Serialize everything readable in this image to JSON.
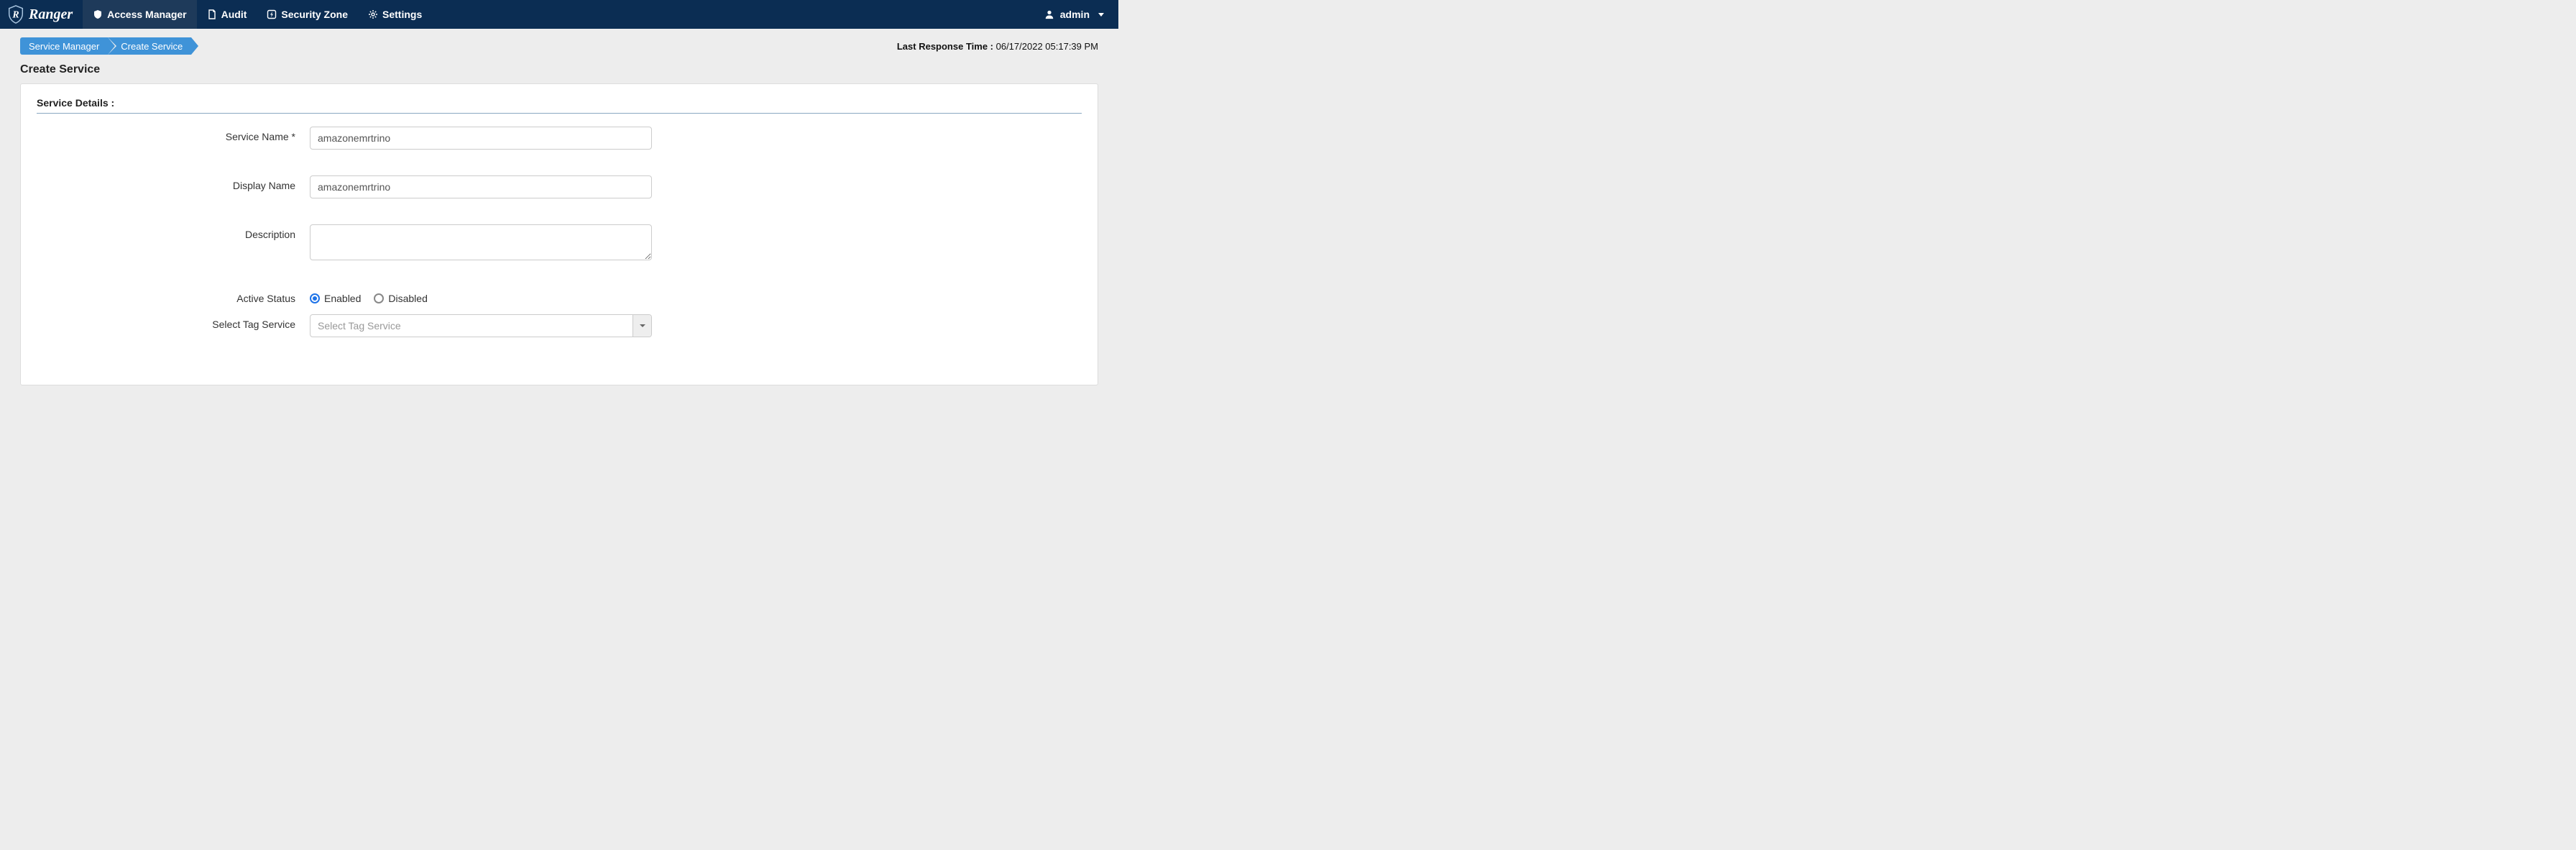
{
  "brand": {
    "name": "Ranger"
  },
  "nav": {
    "items": [
      {
        "label": "Access Manager"
      },
      {
        "label": "Audit"
      },
      {
        "label": "Security Zone"
      },
      {
        "label": "Settings"
      }
    ]
  },
  "user": {
    "name": "admin"
  },
  "breadcrumb": {
    "items": [
      {
        "label": "Service Manager"
      },
      {
        "label": "Create Service"
      }
    ]
  },
  "timestamp": {
    "label": "Last Response Time : ",
    "value": "06/17/2022 05:17:39 PM"
  },
  "page": {
    "title": "Create Service"
  },
  "section": {
    "title": "Service Details :"
  },
  "form": {
    "service_name": {
      "label": "Service Name *",
      "value": "amazonemrtrino"
    },
    "display_name": {
      "label": "Display Name",
      "value": "amazonemrtrino"
    },
    "description": {
      "label": "Description",
      "value": ""
    },
    "active_status": {
      "label": "Active Status",
      "enabled_label": "Enabled",
      "disabled_label": "Disabled",
      "selected": "enabled"
    },
    "tag_service": {
      "label": "Select Tag Service",
      "placeholder": "Select Tag Service"
    }
  }
}
